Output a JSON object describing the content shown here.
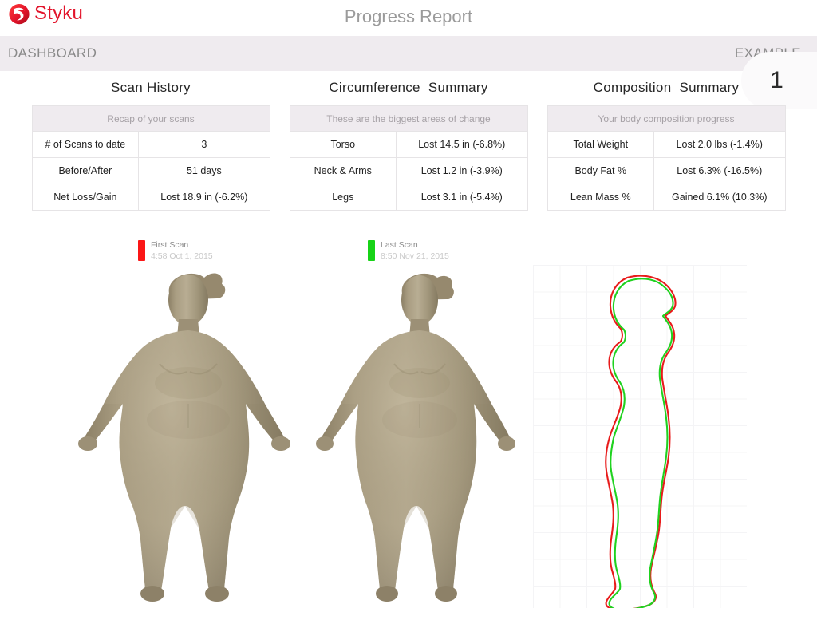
{
  "brand": {
    "name": "Styku",
    "logo_icon": "styku-swirl-logo",
    "color": "#e2132a"
  },
  "header": {
    "title": "Progress Report"
  },
  "nav": {
    "left_label": "DASHBOARD",
    "right_label": "EXAMPLE",
    "page_number": "1"
  },
  "cards": [
    {
      "title": "Scan History",
      "subtitle": "Recap of your scans",
      "rows": [
        {
          "label": "# of Scans to date",
          "value": "3"
        },
        {
          "label": "Before/After",
          "value": "51 days"
        },
        {
          "label": "Net Loss/Gain",
          "value": "Lost 18.9 in (-6.2%)"
        }
      ]
    },
    {
      "title": "Circumference  Summary",
      "subtitle": "These are the biggest areas of change",
      "rows": [
        {
          "label": "Torso",
          "value": "Lost 14.5 in (-6.8%)"
        },
        {
          "label": "Neck & Arms",
          "value": "Lost 1.2 in (-3.9%)"
        },
        {
          "label": "Legs",
          "value": "Lost 3.1 in (-5.4%)"
        }
      ]
    },
    {
      "title": "Composition  Summary",
      "subtitle": "Your body composition progress",
      "rows": [
        {
          "label": "Total Weight",
          "value": "Lost 2.0 lbs (-1.4%)"
        },
        {
          "label": "Body Fat %",
          "value": "Lost 6.3% (-16.5%)"
        },
        {
          "label": "Lean Mass %",
          "value": "Gained 6.1% (10.3%)"
        }
      ]
    }
  ],
  "scans": {
    "first": {
      "name": "First Scan",
      "timestamp": "4:58 Oct 1, 2015",
      "color": "#fb1616"
    },
    "last": {
      "name": "Last Scan",
      "timestamp": "8:50 Nov 21, 2015",
      "color": "#17d317"
    }
  },
  "avatars": {
    "body_color": "#a79b80",
    "first_label": "first-scan-body-model",
    "last_label": "last-scan-body-model"
  },
  "silhouette": {
    "grid_color": "#f4f4f6",
    "first_outline_color": "#e81b1b",
    "last_outline_color": "#1fd21f"
  }
}
